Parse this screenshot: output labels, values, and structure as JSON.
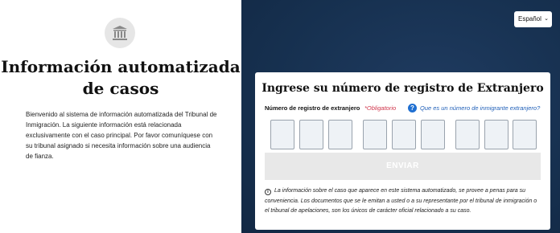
{
  "left": {
    "title": "Información automatizada de casos",
    "welcome": "Bienvenido al sistema de información automatizada del Tribunal de Inmigración. La siguiente información está relacionada exclusivamente con el caso principal. Por favor comuníquese con su tribunal asignado si necesita información sobre una audiencia de fianza.",
    "logo_icon": "courthouse-icon"
  },
  "language": {
    "selected": "Español",
    "options": [
      "Español"
    ]
  },
  "form": {
    "title": "Ingrese su número de registro de Extranjero",
    "field_label": "Número de registro de extranjero",
    "required_label": "*Obligatorio",
    "help_link": "Que es un número de inmigrante extranjero?",
    "digits": [
      "",
      "",
      "",
      "",
      "",
      "",
      "",
      "",
      ""
    ],
    "submit_label": "ENVIAR",
    "info_text": "La información sobre el caso que aparece en este sistema automatizado, se provee a penas para su conveniencia. Los documentos que se le emitan a usted o a su representante por el tribunal de inmigración o el tribunal de apelaciones, son los únicos de carácter oficial relacionado a su caso."
  },
  "colors": {
    "right_background": "#16304f",
    "accent_blue": "#1f6fd1",
    "required_red": "#d0344a"
  }
}
